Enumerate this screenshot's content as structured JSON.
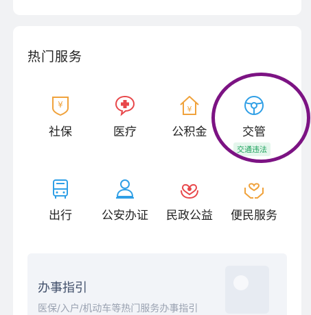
{
  "section": {
    "title": "热门服务"
  },
  "services": [
    {
      "label": "社保",
      "icon": "social-security-icon",
      "color": "#f0a23b"
    },
    {
      "label": "医疗",
      "icon": "medical-icon",
      "color": "#e8474a"
    },
    {
      "label": "公积金",
      "icon": "housing-fund-icon",
      "color": "#f0a23b"
    },
    {
      "label": "交管",
      "icon": "traffic-steering-wheel-icon",
      "color": "#2f9fe6",
      "tag": "交通违法"
    },
    {
      "label": "出行",
      "icon": "bus-icon",
      "color": "#2f9fe6"
    },
    {
      "label": "公安办证",
      "icon": "police-id-icon",
      "color": "#2f9fe6"
    },
    {
      "label": "民政公益",
      "icon": "charity-heart-icon",
      "color": "#e8474a"
    },
    {
      "label": "便民服务",
      "icon": "helping-hands-icon",
      "color": "#f0a23b"
    }
  ],
  "guide": {
    "title": "办事指引",
    "subtitle": "医保/入户/机动车等热门服务办事指引"
  },
  "colors": {
    "highlight": "#7c1383",
    "tag_bg": "#e4f6ec",
    "tag_text": "#20a35e"
  }
}
